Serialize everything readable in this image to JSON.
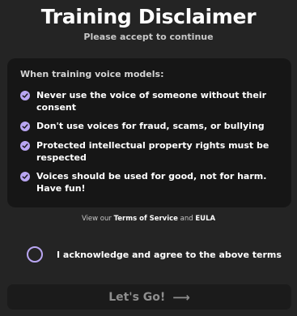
{
  "header": {
    "title": "Training Disclaimer",
    "subtitle": "Please accept to continue"
  },
  "card": {
    "heading": "When training voice models:",
    "rules": [
      {
        "text": "Never use the voice of someone without their consent",
        "icon": "check-circle-icon"
      },
      {
        "text": "Don't use voices for fraud, scams, or bullying",
        "icon": "check-circle-icon"
      },
      {
        "text": "Protected intellectual property rights must be respected",
        "icon": "check-circle-icon"
      },
      {
        "text": "Voices should be used for good, not for harm. Have fun!",
        "icon": "check-circle-icon"
      }
    ]
  },
  "links": {
    "prefix": "View our",
    "terms": "Terms of Service",
    "conjunction": "and",
    "eula": "EULA"
  },
  "agreement": {
    "label": "I acknowledge and agree to the above terms",
    "checked": false
  },
  "action": {
    "label": "Let's Go!",
    "arrow": "⟶",
    "enabled": false
  },
  "colors": {
    "accent": "#b9a6f2",
    "background": "#242424",
    "card": "#161616",
    "button": "#1b1b1b",
    "button_text_disabled": "#8e8e8e"
  }
}
